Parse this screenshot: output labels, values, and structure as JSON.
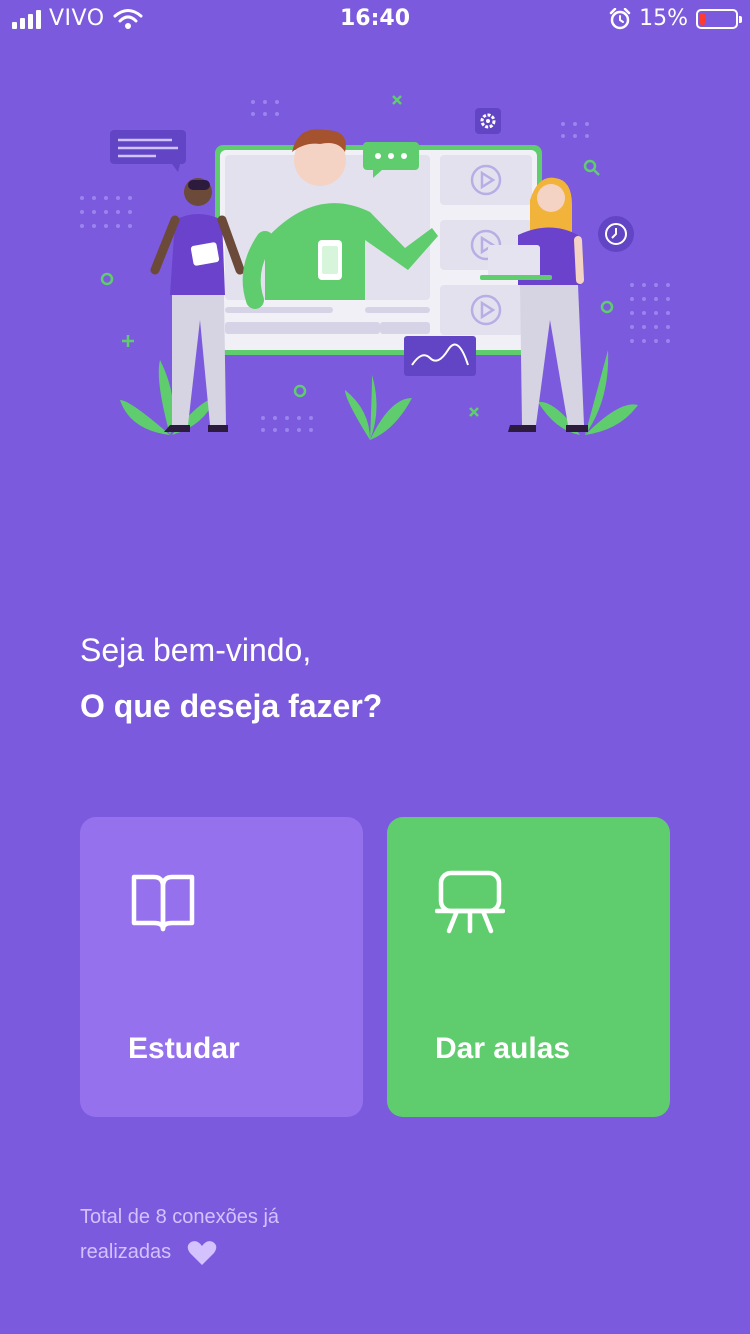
{
  "status_bar": {
    "carrier": "VIVO",
    "time": "16:40",
    "battery_percent": "15%",
    "battery_level": 0.15,
    "battery_color": "#ff3b30"
  },
  "hero": {
    "illustration": "online-class-illustration",
    "icons": [
      "gear-icon",
      "chat-bubble-icon",
      "play-icon",
      "clock-icon",
      "search-icon",
      "chart-icon"
    ]
  },
  "greeting": {
    "welcome": "Seja bem-vindo,",
    "question": "O que deseja fazer?"
  },
  "actions": {
    "study": {
      "label": "Estudar",
      "icon": "book-icon",
      "color": "#9671ee"
    },
    "teach": {
      "label": "Dar aulas",
      "icon": "presentation-icon",
      "color": "#5fcd6d"
    }
  },
  "footer": {
    "line1": "Total de 8 conexões já",
    "line2": "realizadas",
    "icon": "heart-icon"
  },
  "colors": {
    "background": "#7b5ade",
    "accent_green": "#5fcd6d",
    "accent_purple": "#9671ee"
  }
}
